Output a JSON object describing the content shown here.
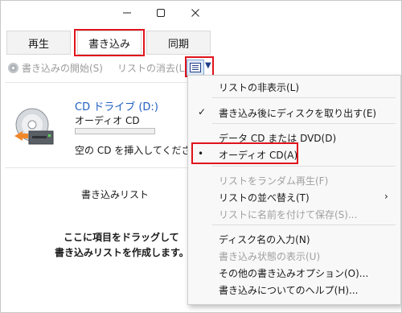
{
  "tabs": [
    {
      "label": "再生"
    },
    {
      "label": "書き込み"
    },
    {
      "label": "同期"
    }
  ],
  "toolbar": {
    "start_burn": "書き込みの開始(S)",
    "clear_list": "リストの消去(L)"
  },
  "panel": {
    "drive_name": "CD ドライブ (D:)",
    "drive_type": "オーディオ CD",
    "progress": 0,
    "insert_message": "空の CD を挿入してください",
    "list_title": "書き込みリスト",
    "drag_line1": "ここに項目をドラッグして",
    "drag_line2": "書き込みリストを作成します。"
  },
  "menu": {
    "hide_list": "リストの非表示(L)",
    "eject_after": "書き込み後にディスクを取り出す(E)",
    "data_cd": "データ CD または DVD(D)",
    "audio_cd": "オーディオ CD(A)",
    "shuffle": "リストをランダム再生(F)",
    "sort": "リストの並べ替え(T)",
    "save_as": "リストに名前を付けて保存(S)...",
    "enter_disc_name": "ディスク名の入力(N)",
    "show_status": "書き込み状態の表示(U)",
    "more_options": "その他の書き込みオプション(O)...",
    "help": "書き込みについてのヘルプ(H)..."
  },
  "colors": {
    "highlight": "#e0141c",
    "link": "#1f5ec2",
    "disabled": "#a0a0a0"
  }
}
